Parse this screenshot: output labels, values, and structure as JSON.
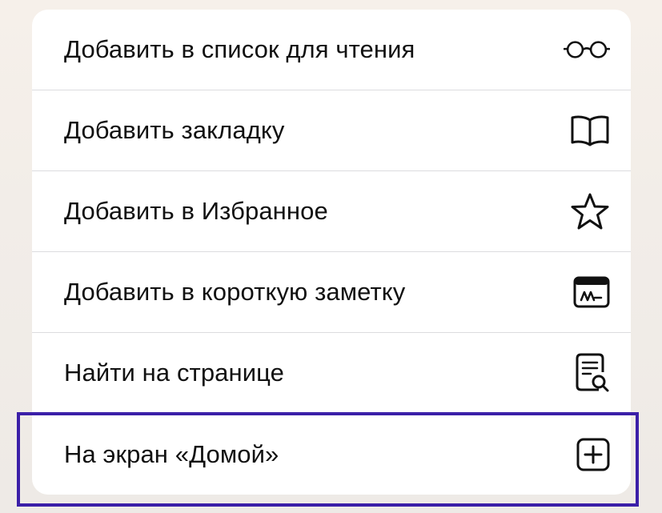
{
  "menu": {
    "items": [
      {
        "label": "Добавить в список для чтения",
        "icon": "reading-list-glasses-icon"
      },
      {
        "label": "Добавить закладку",
        "icon": "bookmark-book-icon"
      },
      {
        "label": "Добавить в Избранное",
        "icon": "star-icon"
      },
      {
        "label": "Добавить в короткую заметку",
        "icon": "quick-note-icon"
      },
      {
        "label": "Найти на странице",
        "icon": "find-on-page-icon"
      },
      {
        "label": "На экран «Домой»",
        "icon": "add-square-icon"
      }
    ]
  },
  "highlight": {
    "target": "На экран «Домой»",
    "color": "#3b1fa8"
  },
  "colors": {
    "text": "#111111",
    "separator": "#dcdcdf",
    "card": "#ffffff"
  }
}
